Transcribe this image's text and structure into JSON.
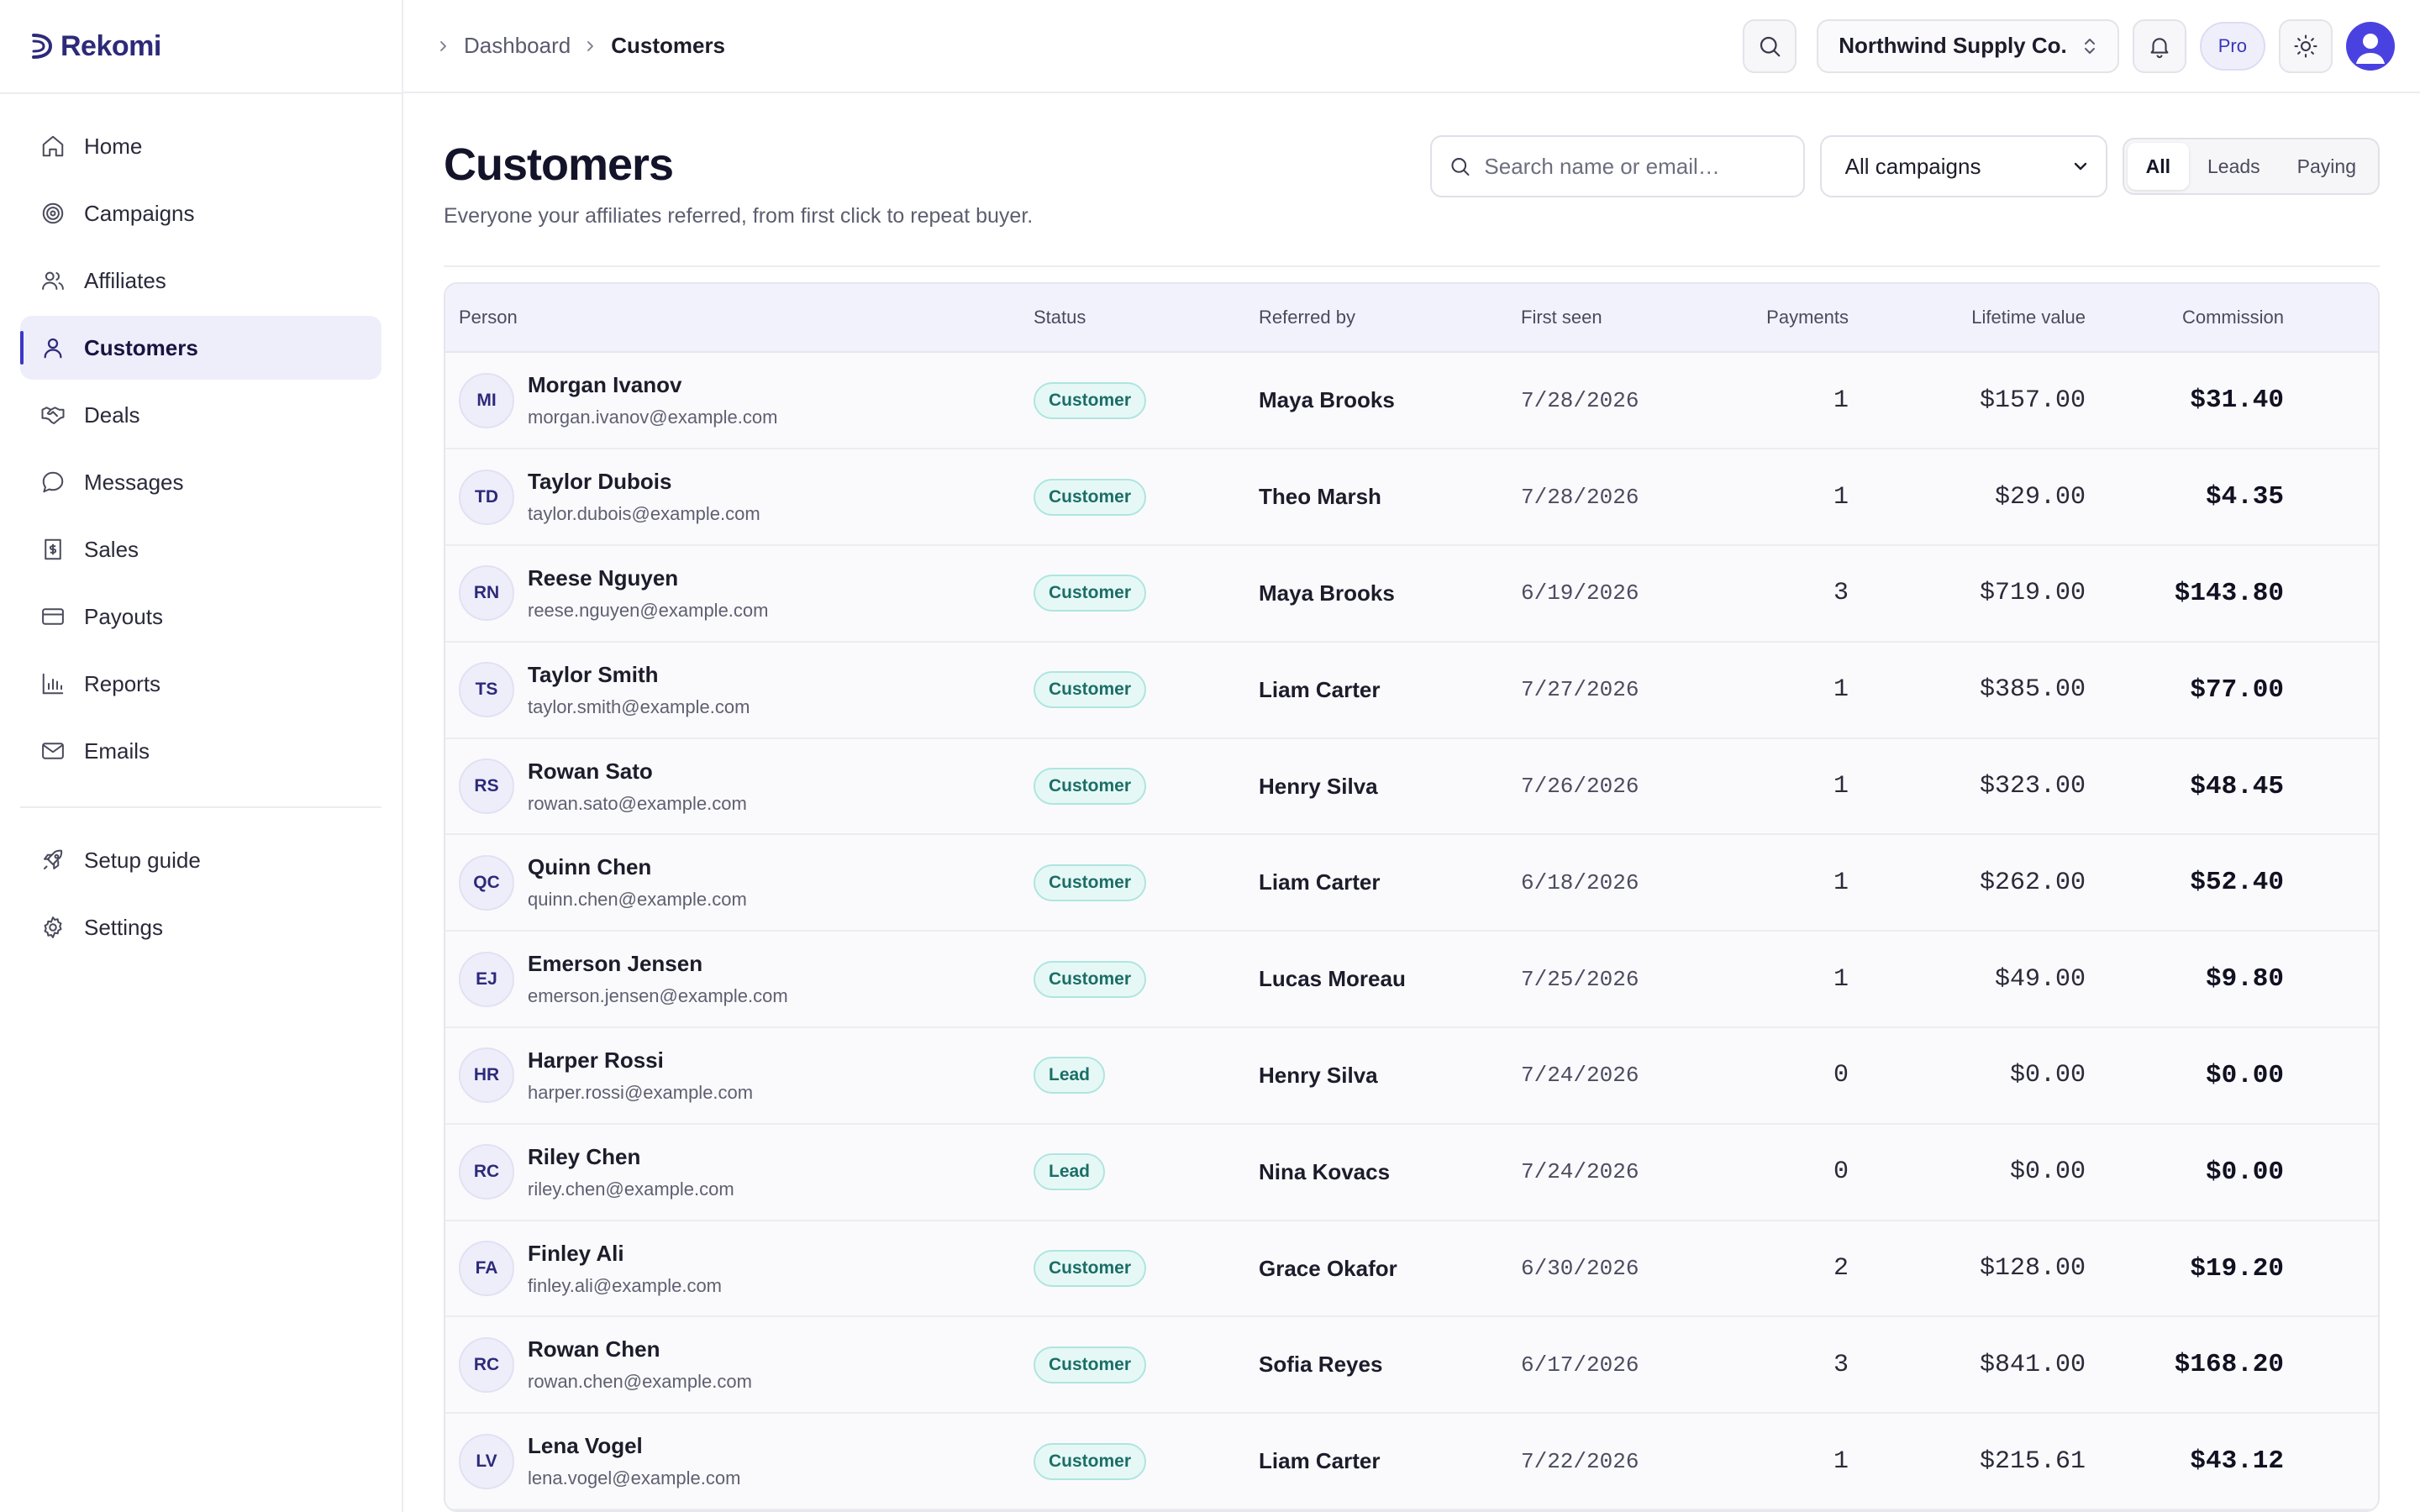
{
  "brand": {
    "name": "Rekomi"
  },
  "sidebar": {
    "items": [
      {
        "label": "Home",
        "icon": "home-icon"
      },
      {
        "label": "Campaigns",
        "icon": "target-icon"
      },
      {
        "label": "Affiliates",
        "icon": "users-icon"
      },
      {
        "label": "Customers",
        "icon": "user-icon",
        "active": true
      },
      {
        "label": "Deals",
        "icon": "handshake-icon"
      },
      {
        "label": "Messages",
        "icon": "message-icon"
      },
      {
        "label": "Sales",
        "icon": "receipt-icon"
      },
      {
        "label": "Payouts",
        "icon": "credit-card-icon"
      },
      {
        "label": "Reports",
        "icon": "bar-chart-icon"
      },
      {
        "label": "Emails",
        "icon": "mail-icon"
      }
    ],
    "secondary": [
      {
        "label": "Setup guide",
        "icon": "rocket-icon"
      },
      {
        "label": "Settings",
        "icon": "gear-icon"
      }
    ]
  },
  "topbar": {
    "breadcrumb": {
      "parent": "Dashboard",
      "current": "Customers"
    },
    "org_name": "Northwind Supply Co.",
    "plan_badge": "Pro"
  },
  "page": {
    "title": "Customers",
    "subtitle": "Everyone your affiliates referred, from first click to repeat buyer.",
    "search_placeholder": "Search name or email…",
    "campaign_filter": "All campaigns",
    "segments": [
      "All",
      "Leads",
      "Paying"
    ],
    "active_segment": "All"
  },
  "table": {
    "columns": {
      "person": "Person",
      "status": "Status",
      "referred_by": "Referred by",
      "first_seen": "First seen",
      "payments": "Payments",
      "lifetime_value": "Lifetime value",
      "commission": "Commission"
    },
    "rows": [
      {
        "initials": "MI",
        "name": "Morgan Ivanov",
        "email": "morgan.ivanov@example.com",
        "status": "Customer",
        "referred_by": "Maya Brooks",
        "first_seen": "7/28/2026",
        "payments": "1",
        "ltv": "$157.00",
        "commission": "$31.40"
      },
      {
        "initials": "TD",
        "name": "Taylor Dubois",
        "email": "taylor.dubois@example.com",
        "status": "Customer",
        "referred_by": "Theo Marsh",
        "first_seen": "7/28/2026",
        "payments": "1",
        "ltv": "$29.00",
        "commission": "$4.35"
      },
      {
        "initials": "RN",
        "name": "Reese Nguyen",
        "email": "reese.nguyen@example.com",
        "status": "Customer",
        "referred_by": "Maya Brooks",
        "first_seen": "6/19/2026",
        "payments": "3",
        "ltv": "$719.00",
        "commission": "$143.80"
      },
      {
        "initials": "TS",
        "name": "Taylor Smith",
        "email": "taylor.smith@example.com",
        "status": "Customer",
        "referred_by": "Liam Carter",
        "first_seen": "7/27/2026",
        "payments": "1",
        "ltv": "$385.00",
        "commission": "$77.00"
      },
      {
        "initials": "RS",
        "name": "Rowan Sato",
        "email": "rowan.sato@example.com",
        "status": "Customer",
        "referred_by": "Henry Silva",
        "first_seen": "7/26/2026",
        "payments": "1",
        "ltv": "$323.00",
        "commission": "$48.45"
      },
      {
        "initials": "QC",
        "name": "Quinn Chen",
        "email": "quinn.chen@example.com",
        "status": "Customer",
        "referred_by": "Liam Carter",
        "first_seen": "6/18/2026",
        "payments": "1",
        "ltv": "$262.00",
        "commission": "$52.40"
      },
      {
        "initials": "EJ",
        "name": "Emerson Jensen",
        "email": "emerson.jensen@example.com",
        "status": "Customer",
        "referred_by": "Lucas Moreau",
        "first_seen": "7/25/2026",
        "payments": "1",
        "ltv": "$49.00",
        "commission": "$9.80"
      },
      {
        "initials": "HR",
        "name": "Harper Rossi",
        "email": "harper.rossi@example.com",
        "status": "Lead",
        "referred_by": "Henry Silva",
        "first_seen": "7/24/2026",
        "payments": "0",
        "ltv": "$0.00",
        "commission": "$0.00"
      },
      {
        "initials": "RC",
        "name": "Riley Chen",
        "email": "riley.chen@example.com",
        "status": "Lead",
        "referred_by": "Nina Kovacs",
        "first_seen": "7/24/2026",
        "payments": "0",
        "ltv": "$0.00",
        "commission": "$0.00"
      },
      {
        "initials": "FA",
        "name": "Finley Ali",
        "email": "finley.ali@example.com",
        "status": "Customer",
        "referred_by": "Grace Okafor",
        "first_seen": "6/30/2026",
        "payments": "2",
        "ltv": "$128.00",
        "commission": "$19.20"
      },
      {
        "initials": "RC",
        "name": "Rowan Chen",
        "email": "rowan.chen@example.com",
        "status": "Customer",
        "referred_by": "Sofia Reyes",
        "first_seen": "6/17/2026",
        "payments": "3",
        "ltv": "$841.00",
        "commission": "$168.20"
      },
      {
        "initials": "LV",
        "name": "Lena Vogel",
        "email": "lena.vogel@example.com",
        "status": "Customer",
        "referred_by": "Liam Carter",
        "first_seen": "7/22/2026",
        "payments": "1",
        "ltv": "$215.61",
        "commission": "$43.12"
      }
    ]
  },
  "colors": {
    "accent": "#3b37c8",
    "brand": "#2d2a7a",
    "badge_bg": "#e6f8f6",
    "badge_text": "#1b6e67"
  }
}
